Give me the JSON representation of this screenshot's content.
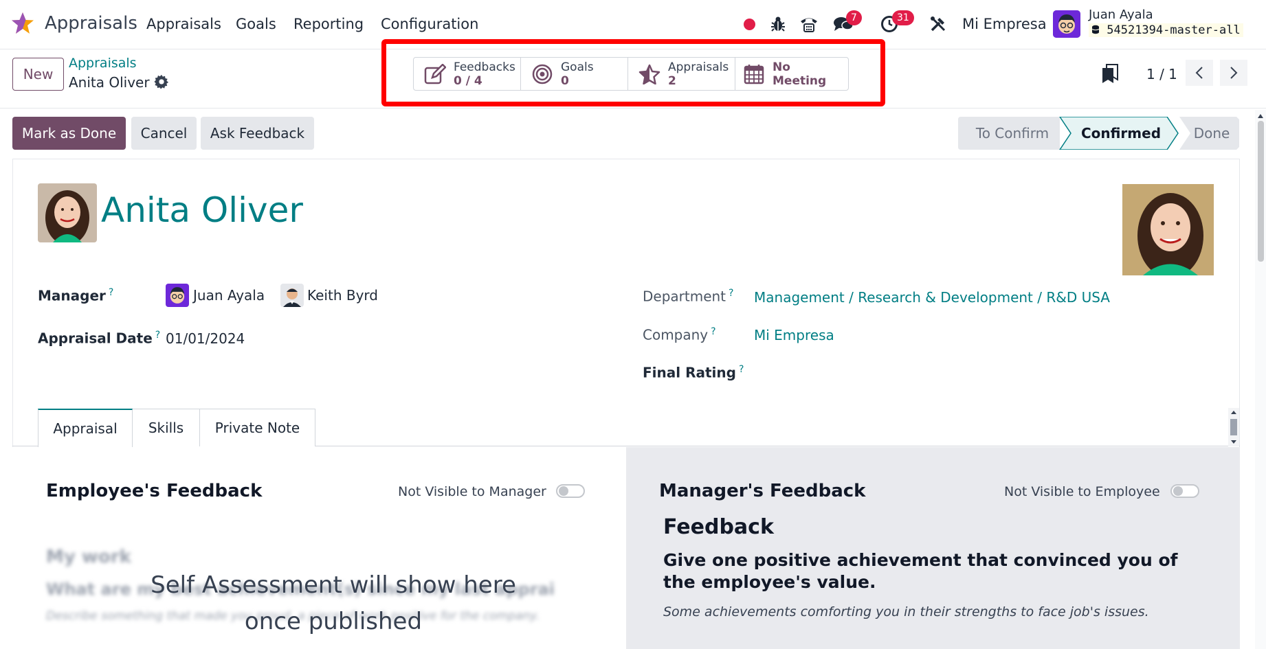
{
  "navbar": {
    "app_name": "Appraisals",
    "menu": [
      "Appraisals",
      "Goals",
      "Reporting",
      "Configuration"
    ],
    "messages_count": "7",
    "activities_count": "31",
    "company": "Mi Empresa",
    "user_name": "Juan Ayala",
    "db_name": "54521394-master-all"
  },
  "control": {
    "new_label": "New",
    "breadcrumb_parent": "Appraisals",
    "breadcrumb_current": "Anita Oliver",
    "pager": "1 / 1"
  },
  "smart_buttons": {
    "feedbacks": {
      "label": "Feedbacks",
      "value": "0 / 4"
    },
    "goals": {
      "label": "Goals",
      "value": "0"
    },
    "appraisals": {
      "label": "Appraisals",
      "value": "2"
    },
    "meeting": {
      "label": "No Meeting"
    }
  },
  "actions": {
    "mark_done": "Mark as Done",
    "cancel": "Cancel",
    "ask_feedback": "Ask Feedback"
  },
  "status": {
    "steps": [
      "To Confirm",
      "Confirmed",
      "Done"
    ],
    "active": "Confirmed"
  },
  "employee": {
    "name": "Anita Oliver"
  },
  "fields": {
    "manager_label": "Manager",
    "managers": [
      "Juan Ayala",
      "Keith Byrd"
    ],
    "appraisal_date_label": "Appraisal Date",
    "appraisal_date": "01/01/2024",
    "department_label": "Department",
    "department": "Management / Research & Development / R&D USA",
    "company_label": "Company",
    "company": "Mi Empresa",
    "final_rating_label": "Final Rating",
    "help": "?"
  },
  "tabs": [
    "Appraisal",
    "Skills",
    "Private Note"
  ],
  "employee_feedback": {
    "title": "Employee's Feedback",
    "toggle_label": "Not Visible to Manager",
    "blurred_heading": "My work",
    "blurred_question": "What are my best achievement(s) since my last appraisal?",
    "blurred_hint": "Describe something that made you proud, a piece of work positive for the company.",
    "overlay_line1": "Self Assessment will show here",
    "overlay_line2": "once published"
  },
  "manager_feedback": {
    "title": "Manager's Feedback",
    "toggle_label": "Not Visible to Employee",
    "heading": "Feedback",
    "question": "Give one positive achievement that convinced you of the employee's value.",
    "hint": "Some achievements comforting you in their strengths to face job's issues."
  },
  "colors": {
    "brand": "#714b67",
    "link": "#017e84",
    "highlight": "#ff0000",
    "badge": "#e11d48"
  }
}
